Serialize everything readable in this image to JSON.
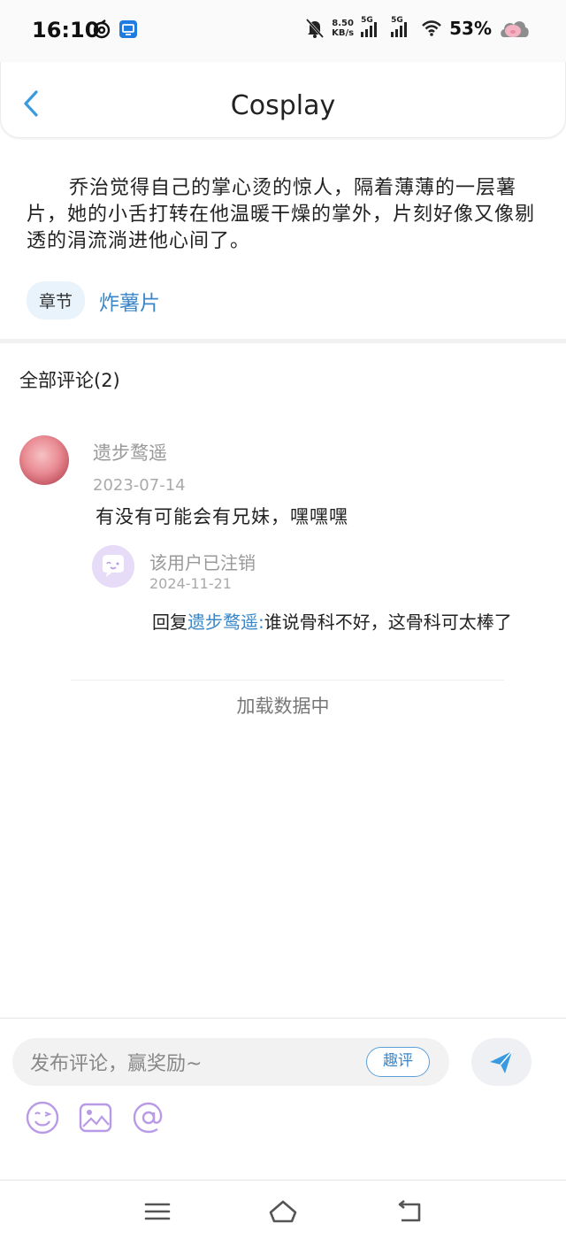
{
  "status_bar": {
    "time": "16:10",
    "net_speed_value": "8.50",
    "net_speed_unit": "KB/s",
    "sig1_label": "5G",
    "sig2_label": "5G",
    "battery": "53%"
  },
  "header": {
    "title": "Cosplay"
  },
  "excerpt": {
    "text": "乔治觉得自己的掌心烫的惊人，隔着薄薄的一层薯片，她的小舌打转在他温暖干燥的掌外，片刻好像又像剔透的涓流淌进他心间了。",
    "chapter_badge": "章节",
    "chapter_name": "炸薯片"
  },
  "comments": {
    "header": "全部评论(2)",
    "items": [
      {
        "username": "遗步鹜遥",
        "date": "2023-07-14",
        "text": "有没有可能会有兄妹，嘿嘿嘿",
        "reply": {
          "username": "该用户已注销",
          "date": "2024-11-21",
          "prefix": "回复",
          "mention": "遗步鹜遥:",
          "text": "谁说骨科不好，这骨科可太棒了"
        }
      }
    ],
    "loading": "加载数据中"
  },
  "input": {
    "placeholder": "发布评论，赢奖励~",
    "quping_label": "趣评"
  },
  "colors": {
    "accent": "#3a86c8",
    "badge_bg": "#e9f3fb",
    "tool_icon": "#b89ae6"
  }
}
